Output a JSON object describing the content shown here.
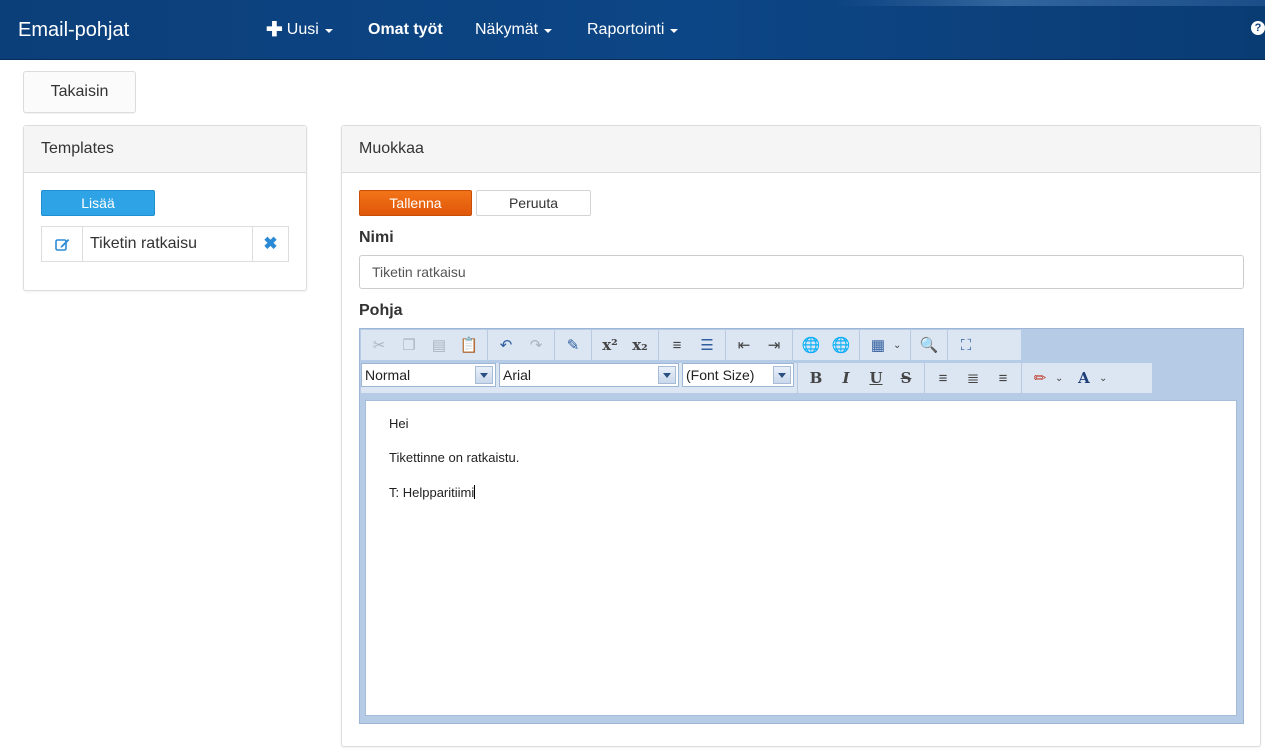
{
  "navbar": {
    "brand": "Email-pohjat",
    "new_label": "Uusi",
    "new_icon": "plus-icon",
    "my_work_label": "Omat työt",
    "views_label": "Näkymät",
    "reporting_label": "Raportointi",
    "help_glyph": "?",
    "help_icon": "question-icon"
  },
  "back_button": "Takaisin",
  "templates_panel": {
    "title": "Templates",
    "add_button": "Lisää",
    "items": [
      {
        "name": "Tiketin ratkaisu",
        "edit_icon": "edit-icon",
        "delete_icon": "close-icon"
      }
    ]
  },
  "edit_panel": {
    "title": "Muokkaa",
    "save_button": "Tallenna",
    "cancel_button": "Peruuta",
    "name_label": "Nimi",
    "name_value": "Tiketin ratkaisu",
    "template_label": "Pohja",
    "editor": {
      "format_select": "Normal",
      "font_select": "Arial",
      "size_select": "(Font Size)",
      "bold_glyph": "B",
      "italic_glyph": "I",
      "underline_glyph": "U",
      "strike_glyph": "S",
      "fontcolor_glyph": "A",
      "body_lines": [
        "Hei",
        "Tikettinne on ratkaistu.",
        "T: Helpparitiimi"
      ]
    }
  },
  "colors": {
    "navbar": "#0d4686",
    "primary": "#2ea3e6",
    "save": "#e8620f",
    "editor_frame": "#b6cbe6"
  }
}
